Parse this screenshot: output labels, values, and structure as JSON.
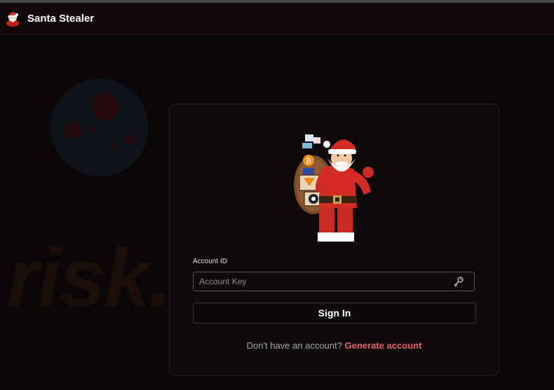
{
  "app": {
    "title": "Santa Stealer"
  },
  "login": {
    "field_label": "Account ID",
    "input_value": "",
    "input_placeholder": "Account Key",
    "signin_label": "Sign In",
    "signup_prompt": "Don't have an account?",
    "signup_link": "Generate account"
  },
  "watermark": {
    "text": "risk.com"
  },
  "icons": {
    "logo": "santa-logo-icon",
    "hero": "santa-with-sack-illustration",
    "input": "key-icon"
  },
  "colors": {
    "background": "#0b0708",
    "accent": "#e8606b",
    "santa_red": "#d42b24"
  }
}
